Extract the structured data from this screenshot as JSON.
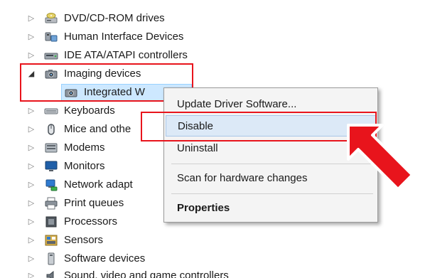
{
  "device_manager": {
    "categories": [
      {
        "label": "DVD/CD-ROM drives",
        "icon": "dvd-drive-icon",
        "expanded": false
      },
      {
        "label": "Human Interface Devices",
        "icon": "hid-icon",
        "expanded": false
      },
      {
        "label": "IDE ATA/ATAPI controllers",
        "icon": "ide-controller-icon",
        "expanded": false
      },
      {
        "label": "Imaging devices",
        "icon": "camera-icon",
        "expanded": true
      },
      {
        "label": "Integrated W",
        "icon": "webcam-icon",
        "child": true,
        "selected": true
      },
      {
        "label": "Keyboards",
        "icon": "keyboard-icon",
        "expanded": false
      },
      {
        "label": "Mice and othe",
        "icon": "mouse-icon",
        "expanded": false
      },
      {
        "label": "Modems",
        "icon": "modem-icon",
        "expanded": false
      },
      {
        "label": "Monitors",
        "icon": "monitor-icon",
        "expanded": false
      },
      {
        "label": "Network adapt",
        "icon": "network-adapter-icon",
        "expanded": false
      },
      {
        "label": "Print queues",
        "icon": "printer-icon",
        "expanded": false
      },
      {
        "label": "Processors",
        "icon": "processor-icon",
        "expanded": false
      },
      {
        "label": "Sensors",
        "icon": "sensor-icon",
        "expanded": false
      },
      {
        "label": "Software devices",
        "icon": "software-device-icon",
        "expanded": false
      },
      {
        "label": "Sound, video and game controllers",
        "icon": "sound-icon",
        "expanded": false
      }
    ]
  },
  "context_menu": {
    "items": [
      {
        "label": "Update Driver Software...",
        "bold": false
      },
      {
        "label": "Disable",
        "bold": false,
        "hover": true
      },
      {
        "label": "Uninstall",
        "bold": false
      },
      {
        "label": "Scan for hardware changes",
        "bold": false
      },
      {
        "label": "Properties",
        "bold": true
      }
    ]
  },
  "colors": {
    "annotation_red": "#e8141c",
    "selection_blue": "#cde8ff",
    "menu_hover": "#dce9f7"
  }
}
